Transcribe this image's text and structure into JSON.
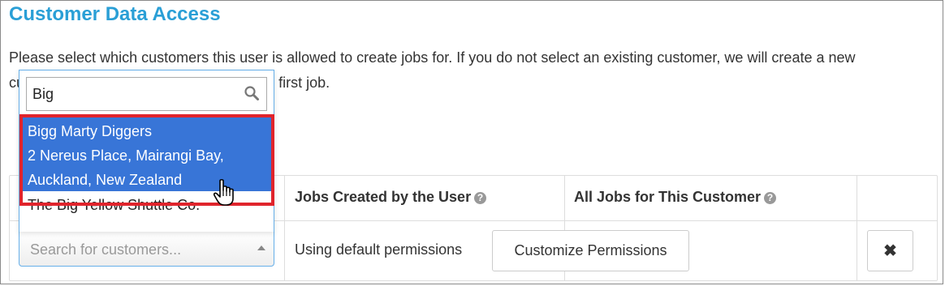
{
  "page": {
    "title": "Customer Data Access",
    "description_line1": "Please select which customers this user is allowed to create jobs for. If you do not select an existing customer, we will create a new",
    "description_line2": "customer for them when they create their first job."
  },
  "table": {
    "columns": [
      {
        "label": "Jobs Created by the User"
      },
      {
        "label": "All Jobs for This Customer"
      }
    ],
    "row": {
      "permissions_text": "Using default permissions",
      "customize_button": "Customize Permissions",
      "remove_button": "✖"
    }
  },
  "customer_select": {
    "placeholder": "Search for customers...",
    "search_value": "Big",
    "options": [
      {
        "line1": "Bigg Marty Diggers",
        "line2": "2 Nereus Place, Mairangi Bay,",
        "line3": "Auckland, New Zealand",
        "highlighted": true
      },
      {
        "line1": "The Big Yellow Shuttle Co.",
        "highlighted": false
      }
    ]
  },
  "icons": {
    "search": "search-icon",
    "help": "question-circle-icon",
    "cursor": "hand-pointer-icon"
  },
  "colors": {
    "title": "#2a9fd6",
    "highlight": "#3875d7",
    "annotation": "#e0242c"
  }
}
